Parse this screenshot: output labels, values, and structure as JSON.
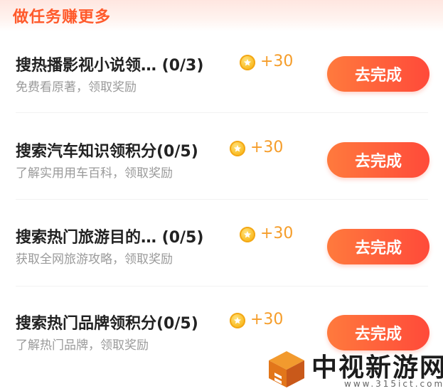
{
  "header": {
    "title": "做任务赚更多"
  },
  "tasks": [
    {
      "title": "搜热播影视小说领… (0/3)",
      "reward": "+30",
      "desc": "免费看原著，领取奖励",
      "button": "去完成"
    },
    {
      "title": "搜索汽车知识领积分(0/5)",
      "reward": "+30",
      "desc": "了解实用用车百科，领取奖励",
      "button": "去完成"
    },
    {
      "title": "搜索热门旅游目的… (0/5)",
      "reward": "+30",
      "desc": "获取全网旅游攻略，领取奖励",
      "button": "去完成"
    },
    {
      "title": "搜索热门品牌领积分(0/5)",
      "reward": "+30",
      "desc": "了解热门品牌，领取奖励",
      "button": "去完成"
    }
  ],
  "watermark": {
    "text": "中视新游网",
    "url": "www.315ict.com"
  },
  "icons": {
    "reward": "coin-icon",
    "watermark_logo": "cube-logo-icon"
  },
  "colors": {
    "accent": "#ff5a2b",
    "button_start": "#ff7a3d",
    "button_end": "#ff4a3a",
    "reward_text": "#f59d2a",
    "coin": "#f9b81a"
  }
}
